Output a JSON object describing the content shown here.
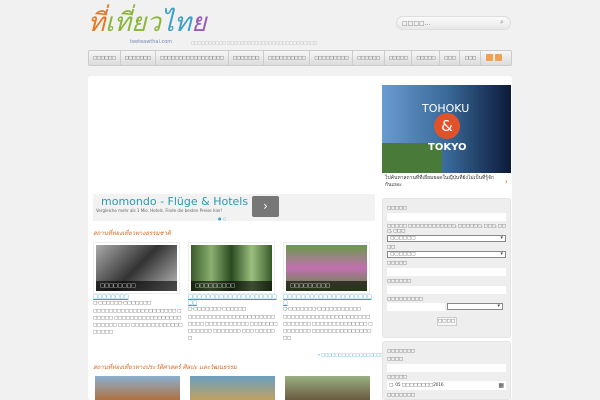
{
  "header": {
    "logo_parts": [
      "ที่",
      "เที่ยว",
      "ไท",
      "ย"
    ],
    "logo_sub": "teeteawthai.com",
    "tagline": "□□□□□□□□□□ □□□□□□□□□□□□□□□□□□□□□□□□□□",
    "search_placeholder": "□□□□..."
  },
  "nav": [
    "□□□□□□",
    "□□□□□□□",
    "□□□□□□□□□□□□□□□□□",
    "□□□□□□□",
    "□□□□□□□□□□",
    "□□□□□□□□□",
    "□□□□□□",
    "□□□□□",
    "□□□□□",
    "□□□",
    "□□□"
  ],
  "ad": {
    "title": "momondo - Flüge & Hotels",
    "subtitle": "Vergleiche mehr als 1 Mio. Hotels. Finde die besten Preise hier!",
    "button": "›",
    "dots": "● ○"
  },
  "section1": {
    "heading": "สถานที่ท่องเที่ยวทางธรรมชาติ",
    "cards": [
      {
        "caption": "□□□□□□□□",
        "title": "□□□□□□□□",
        "date": "□-□□□□□□-□□□□□□□",
        "desc": "□□□□□□□□□□□□□□□□□□□□□ □□□□□□ □□□□□□□□□□□□□□□□□□□□□□□ □□□ □□□□□□□□□□□□□□□□□□"
      },
      {
        "caption": "□□□□□□□□□",
        "title": "□□□□□□□□□□□□□□□□□□□□□□",
        "date": "□-□□□□□□□-□□□□□□",
        "desc": "□□□□□□□□□□□□□□□□□□□□□□□□□□ □□□□□□□□□□□ □□□□□□□□□□□□□ □□□□□□□ □□□ □□□□□□"
      },
      {
        "caption": "□□□□□□□□□",
        "title": "□□□□□□□□□□□□□□□□□□□□□",
        "date": "□-□□□□□□□-□□□□□□□□□□□",
        "desc": "□□□□□□□□□□□□□□□□□□□□□□□□□□□□□ □□□□□□□□□□□□□□ □□□□□□□□ □□□□□□□□□□□□□□□□□"
      }
    ],
    "more": "» □□□□□□□□□□□□□□□□□□"
  },
  "section2": {
    "heading": "สถานที่ท่องเที่ยวทางประวัติศาสตร์ ศิลปะ และวัฒนธรรม"
  },
  "sidebar": {
    "ad": {
      "line1": "TOHOKU",
      "amp": "&",
      "line2": "TOKYO",
      "caption": "ไปค้นหาสถานที่ที่เยี่ยมยอดในญี่ปุ่นที่ยังไม่เป็นที่รู้จักกันเถอะ",
      "arrow": "›"
    },
    "form": {
      "f1": "□□□□□",
      "f2": "□□□□□ □□□□□□□□□□□□, □□□□□□, □□□, □□□, □□□",
      "sel1": "□□□□□□",
      "f3": "□□",
      "sel2": "□□□□□□",
      "f4": "□□□□□",
      "f5": "□□□□□□",
      "f6": "□□□□□□□□□",
      "submit": "□□□□"
    },
    "box2": {
      "title": "□□□□□□□",
      "f1": "□□□□",
      "f2": "□□□□□",
      "date": "□. 05 □□□□□□□□2016",
      "f3": "□□□□□□□"
    }
  }
}
